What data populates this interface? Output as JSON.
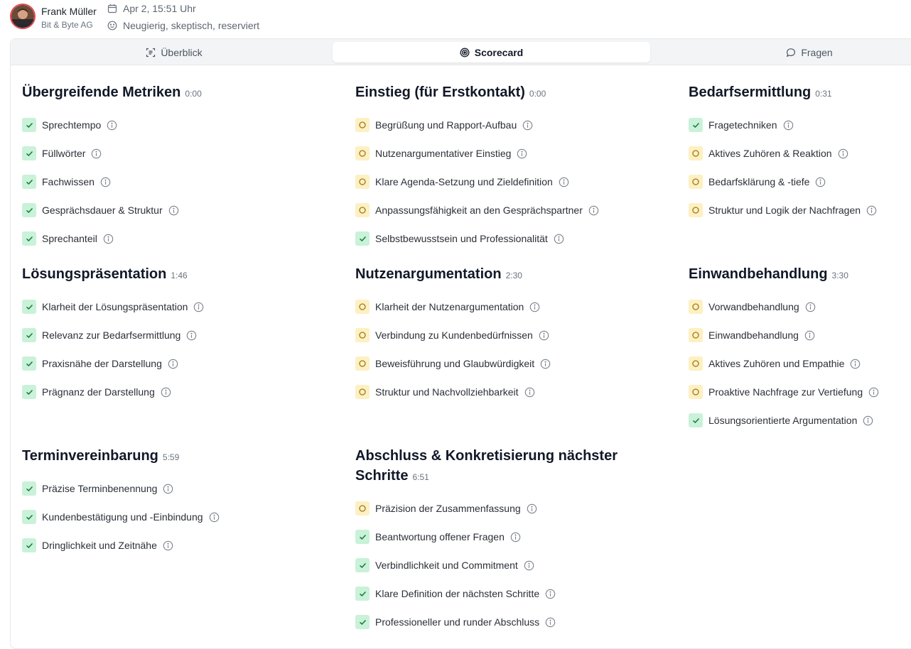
{
  "header": {
    "name": "Frank Müller",
    "company": "Bit & Byte AG",
    "date": "Apr 2, 15:51 Uhr",
    "mood": "Neugierig, skeptisch, reserviert"
  },
  "tabs": [
    {
      "label": "Überblick",
      "icon": "overview-icon"
    },
    {
      "label": "Scorecard",
      "icon": "target-icon",
      "active": true
    },
    {
      "label": "Fragen",
      "icon": "chat-bubble-icon"
    }
  ],
  "colors": {
    "done_bg": "#c9f2d9",
    "done_check": "#1f7a45",
    "open_bg": "#fdf0c2",
    "open_ring": "#a0781a",
    "avatar_ring": "#e5484d"
  },
  "sections": [
    {
      "title": "Übergreifende Metriken",
      "time": "0:00",
      "items": [
        {
          "label": "Sprechtempo",
          "status": "done"
        },
        {
          "label": "Füllwörter",
          "status": "done"
        },
        {
          "label": "Fachwissen",
          "status": "done"
        },
        {
          "label": "Gesprächsdauer & Struktur",
          "status": "done"
        },
        {
          "label": "Sprechanteil",
          "status": "done"
        }
      ]
    },
    {
      "title": "Einstieg (für Erstkontakt)",
      "time": "0:00",
      "items": [
        {
          "label": "Begrüßung und Rapport-Aufbau",
          "status": "open"
        },
        {
          "label": "Nutzenargumentativer Einstieg",
          "status": "open"
        },
        {
          "label": "Klare Agenda-Setzung und Zieldefinition",
          "status": "open"
        },
        {
          "label": "Anpassungsfähigkeit an den Gesprächspartner",
          "status": "open"
        },
        {
          "label": "Selbstbewusstsein und Professionalität",
          "status": "done"
        }
      ]
    },
    {
      "title": "Bedarfsermittlung",
      "time": "0:31",
      "items": [
        {
          "label": "Fragetechniken",
          "status": "done"
        },
        {
          "label": "Aktives Zuhören & Reaktion",
          "status": "open"
        },
        {
          "label": "Bedarfsklärung & -tiefe",
          "status": "open"
        },
        {
          "label": "Struktur und Logik der Nachfragen",
          "status": "open"
        }
      ]
    },
    {
      "title": "Lösungspräsentation",
      "time": "1:46",
      "items": [
        {
          "label": "Klarheit der Lösungspräsentation",
          "status": "done"
        },
        {
          "label": "Relevanz zur Bedarfsermittlung",
          "status": "done"
        },
        {
          "label": "Praxisnähe der Darstellung",
          "status": "done"
        },
        {
          "label": "Prägnanz der Darstellung",
          "status": "done"
        }
      ]
    },
    {
      "title": "Nutzenargumentation",
      "time": "2:30",
      "items": [
        {
          "label": "Klarheit der Nutzenargumentation",
          "status": "open"
        },
        {
          "label": "Verbindung zu Kundenbedürfnissen",
          "status": "open"
        },
        {
          "label": "Beweisführung und Glaubwürdigkeit",
          "status": "open"
        },
        {
          "label": "Struktur und Nachvollziehbarkeit",
          "status": "open"
        }
      ]
    },
    {
      "title": "Einwandbehandlung",
      "time": "3:30",
      "items": [
        {
          "label": "Vorwandbehandlung",
          "status": "open"
        },
        {
          "label": "Einwandbehandlung",
          "status": "open"
        },
        {
          "label": "Aktives Zuhören und Empathie",
          "status": "open"
        },
        {
          "label": "Proaktive Nachfrage zur Vertiefung",
          "status": "open"
        },
        {
          "label": "Lösungsorientierte Argumentation",
          "status": "done"
        }
      ]
    },
    {
      "title": "Terminvereinbarung",
      "time": "5:59",
      "items": [
        {
          "label": "Präzise Terminbenennung",
          "status": "done"
        },
        {
          "label": "Kundenbestätigung und -Einbindung",
          "status": "done"
        },
        {
          "label": "Dringlichkeit und Zeitnähe",
          "status": "done"
        }
      ]
    },
    {
      "title": "Abschluss & Konkretisierung nächster Schritte",
      "time": "6:51",
      "items": [
        {
          "label": "Präzision der Zusammenfassung",
          "status": "open"
        },
        {
          "label": "Beantwortung offener Fragen",
          "status": "done"
        },
        {
          "label": "Verbindlichkeit und Commitment",
          "status": "done"
        },
        {
          "label": "Klare Definition der nächsten Schritte",
          "status": "done"
        },
        {
          "label": "Professioneller und runder Abschluss",
          "status": "done"
        }
      ]
    }
  ]
}
